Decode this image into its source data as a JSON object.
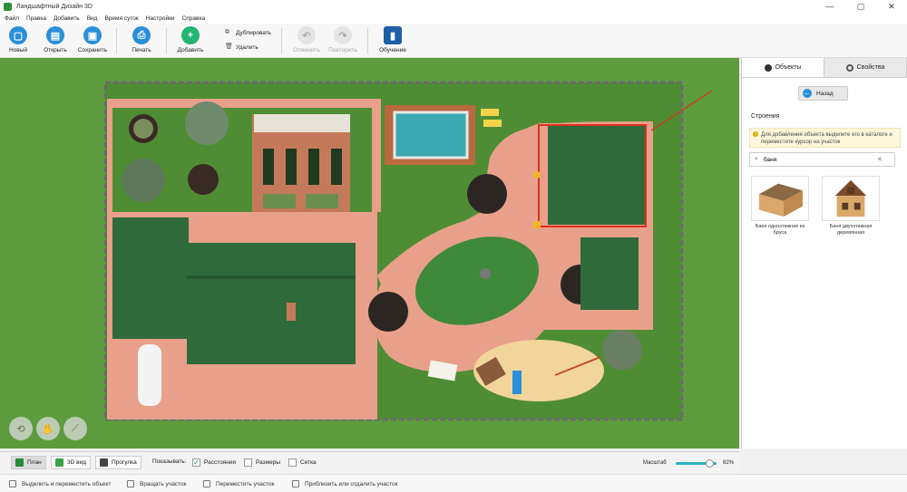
{
  "window": {
    "title": "Ландшафтный Дизайн 3D",
    "controls": [
      "—",
      "▢",
      "✕"
    ]
  },
  "menu": [
    "Файл",
    "Правка",
    "Добавить",
    "Вид",
    "Время суток",
    "Настройки",
    "Справка"
  ],
  "toolbar": {
    "new": "Новый",
    "open": "Открыть",
    "save": "Сохранить",
    "print": "Печать",
    "add": "Добавить",
    "duplicate": "Дублировать",
    "delete": "Удалить",
    "undo": "Отменить",
    "redo": "Повторить",
    "tutorial": "Обучение"
  },
  "panel": {
    "tab_objects": "Объекты",
    "tab_properties": "Свойства",
    "back": "Назад",
    "section": "Строения",
    "hint": "Для добавления объекта выделите его в каталоге и переместите курсор на участок",
    "search_value": "баня",
    "items": [
      {
        "label": "Баня одноэтажная из бруса"
      },
      {
        "label": "Баня двухэтажная деревянная"
      }
    ]
  },
  "bottom": {
    "view_plan": "План",
    "view_3d": "3D вид",
    "view_walk": "Прогулка",
    "show_label": "Показывать:",
    "show_distances": "Расстояния",
    "show_dimensions": "Размеры",
    "show_grid": "Сетка",
    "show_distances_checked": true,
    "show_dimensions_checked": false,
    "show_grid_checked": false,
    "zoom_label": "Масштаб",
    "zoom_value": "82%",
    "zoom_fraction": 0.82
  },
  "status": [
    "Выделить и переместить объект",
    "Вращать участок",
    "Переместить участок",
    "Приблизить или отдалить участок"
  ],
  "colors": {
    "accent": "#2a8fd9",
    "grass": "#5d9c3e",
    "paving": "#e8a08a",
    "roof": "#2f6b3a",
    "selection": "#e03020"
  }
}
